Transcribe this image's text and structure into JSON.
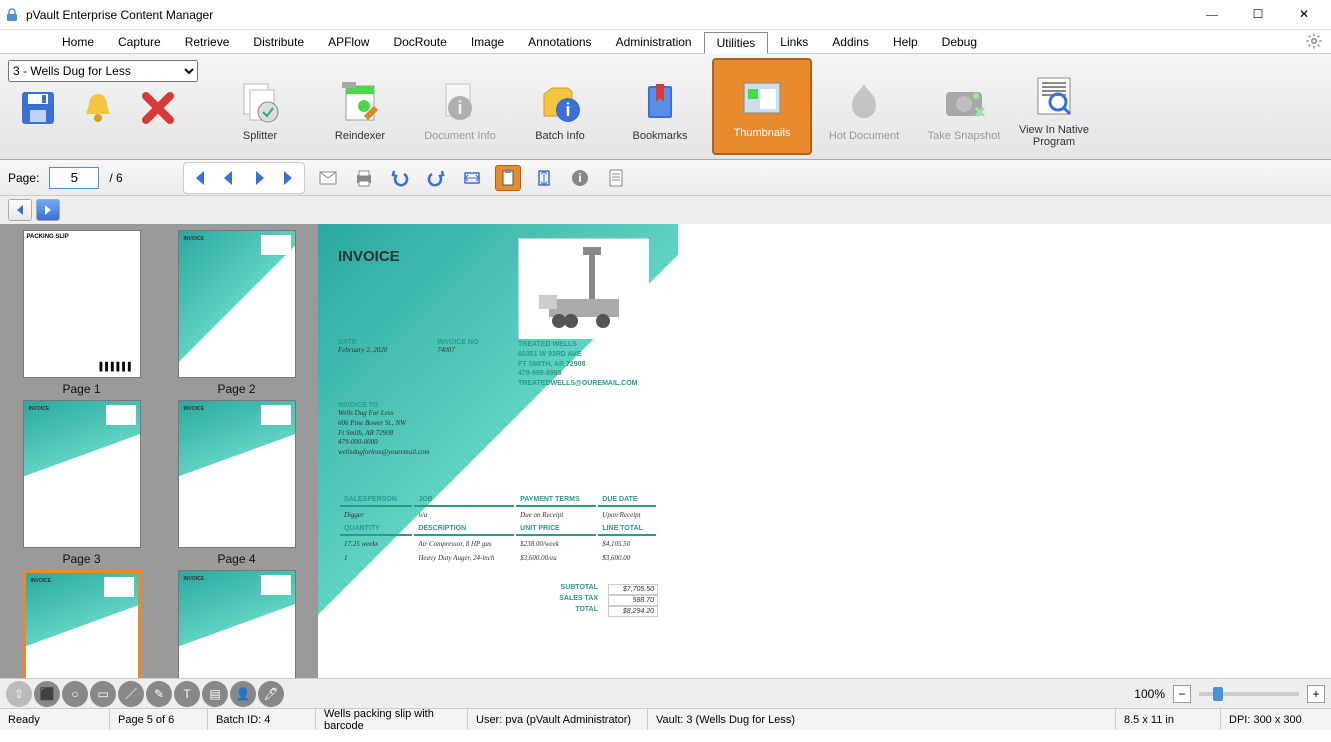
{
  "window": {
    "title": "pVault Enterprise Content Manager"
  },
  "menu": {
    "items": [
      "Home",
      "Capture",
      "Retrieve",
      "Distribute",
      "APFlow",
      "DocRoute",
      "Image",
      "Annotations",
      "Administration",
      "Utilities",
      "Links",
      "Addins",
      "Help",
      "Debug"
    ],
    "active": 9
  },
  "vault_select": "3 - Wells Dug for Less",
  "ribbon": [
    {
      "label": "Splitter",
      "icon": "splitter",
      "disabled": false
    },
    {
      "label": "Reindexer",
      "icon": "reindexer",
      "disabled": false
    },
    {
      "label": "Document Info",
      "icon": "docinfo",
      "disabled": true
    },
    {
      "label": "Batch Info",
      "icon": "batchinfo",
      "disabled": false
    },
    {
      "label": "Bookmarks",
      "icon": "bookmarks",
      "disabled": false
    },
    {
      "label": "Thumbnails",
      "icon": "thumbnails",
      "disabled": false,
      "active": true
    },
    {
      "label": "Hot Document",
      "icon": "hot",
      "disabled": true
    },
    {
      "label": "Take Snapshot",
      "icon": "snapshot",
      "disabled": true
    },
    {
      "label": "View In Native Program",
      "icon": "native",
      "disabled": false
    }
  ],
  "pagebar": {
    "label": "Page:",
    "current": "5",
    "total": "/ 6"
  },
  "thumbs": [
    {
      "cap": "Page 1",
      "type": "slip"
    },
    {
      "cap": "Page 2",
      "type": "inv"
    },
    {
      "cap": "Page 3",
      "type": "inv2"
    },
    {
      "cap": "Page 4",
      "type": "inv2"
    },
    {
      "cap": "",
      "type": "inv2",
      "sel": true
    },
    {
      "cap": "",
      "type": "inv2"
    }
  ],
  "doc": {
    "title": "INVOICE",
    "date_lbl": "DATE",
    "date": "February 2, 2020",
    "inv_lbl": "INVOICE NO",
    "inv": "74007",
    "company": "TREATED WELLS",
    "addr1": "60351 W 93RD AVE",
    "addr2": "FT SMITH, AR 72908",
    "phone": "479-999-9999",
    "email": "TREATEDWELLS@OUREMAIL.COM",
    "invto_lbl": "INVOICE TO",
    "invto_name": "Wells Dug For Less",
    "invto_addr1": "606 Pine Bower St., NW",
    "invto_addr2": "Ft Smith, AR 72908",
    "invto_phone": "479-000-0000",
    "invto_email": "wellsdugforless@youremail.com",
    "h_sales": "SALESPERSON",
    "h_job": "JOB",
    "h_pay": "PAYMENT TERMS",
    "h_due": "DUE DATE",
    "v_sales": "Digger",
    "v_job": "n/a",
    "v_pay": "Due on Receipt",
    "v_due": "Upon Receipt",
    "h_qty": "QUANTITY",
    "h_desc": "DESCRIPTION",
    "h_unit": "UNIT PRICE",
    "h_line": "LINE TOTAL",
    "rows": [
      {
        "q": "17.25 weeks",
        "d": "Air Compressor, 8 HP gas",
        "u": "$238.00/week",
        "t": "$4,105.50"
      },
      {
        "q": "1",
        "d": "Heavy Duty Auger, 24-inch",
        "u": "$3,600.00/ea",
        "t": "$3,600.00"
      }
    ],
    "sub_l": "SUBTOTAL",
    "sub_v": "$7,705.50",
    "tax_l": "SALES TAX",
    "tax_v": "588.70",
    "tot_l": "TOTAL",
    "tot_v": "$8,294.20"
  },
  "zoom": "100%",
  "status": {
    "ready": "Ready",
    "page": "Page 5 of 6",
    "batch": "Batch ID: 4",
    "desc": "Wells packing slip with barcode",
    "user": "User: pva (pVault Administrator)",
    "vault": "Vault: 3 (Wells Dug for Less)",
    "size": "8.5 x 11 in",
    "dpi": "DPI: 300 x 300"
  }
}
